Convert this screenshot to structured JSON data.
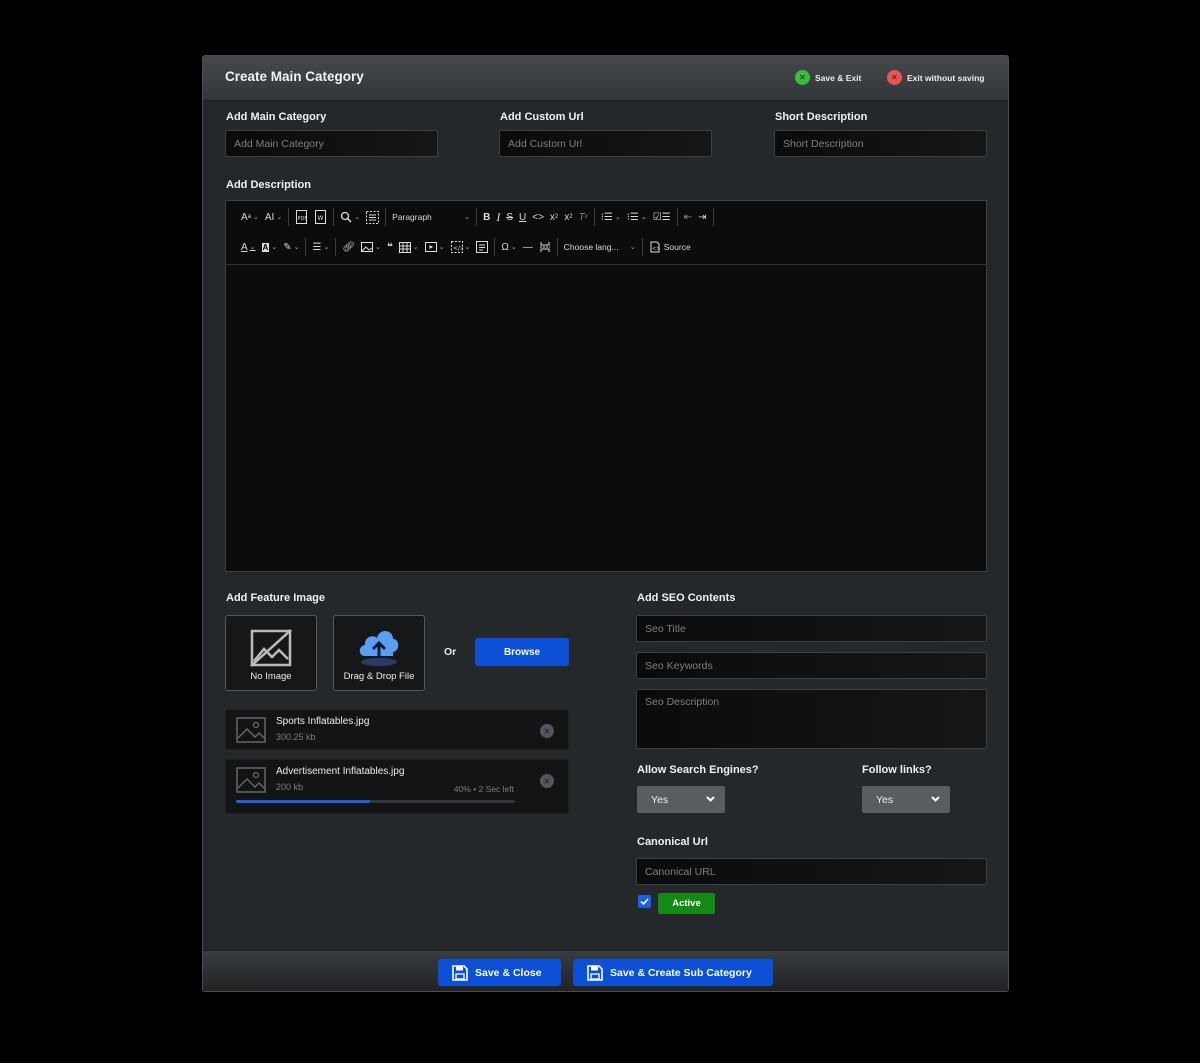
{
  "modal": {
    "title": "Create Main Category",
    "save_exit": "Save & Exit",
    "exit_no_save": "Exit without saving"
  },
  "fields": {
    "main_category": {
      "label": "Add Main Category",
      "placeholder": "Add Main Category",
      "value": ""
    },
    "custom_url": {
      "label": "Add Custom Url",
      "placeholder": "Add Custom Url",
      "value": ""
    },
    "short_description": {
      "label": "Short Description",
      "placeholder": "Short Description",
      "value": ""
    },
    "description_label": "Add Description"
  },
  "editor": {
    "paragraph": "Paragraph",
    "choose_language": "Choose lang...",
    "source": "Source"
  },
  "feature_image": {
    "label": "Add Feature Image",
    "no_image": "No Image",
    "drag_drop": "Drag & Drop File",
    "or": "Or",
    "browse": "Browse",
    "files": [
      {
        "name": "Sports Inflatables.jpg",
        "size": "300.25 kb"
      },
      {
        "name": "Advertisement Inflatables.jpg",
        "size": "200 kb",
        "status": "40% • 2 Sec left",
        "progress": 0.48
      }
    ]
  },
  "seo": {
    "label": "Add SEO Contents",
    "title_placeholder": "Seo Title",
    "keywords_placeholder": "Seo Keywords",
    "description_placeholder": "Seo Description",
    "allow_label": "Allow Search Engines?",
    "allow_value": "Yes",
    "follow_label": "Follow links?",
    "follow_value": "Yes",
    "canonical_label": "Canonical Url",
    "canonical_placeholder": "Canonical URL",
    "active_label": "Active",
    "active_checked": true
  },
  "footer": {
    "save_close": "Save & Close",
    "save_create_sub": "Save & Create Sub Category"
  },
  "colors": {
    "accent": "#0d50d8",
    "success": "#128a13",
    "save_dot": "#3bbd3b",
    "exit_dot": "#e8574f"
  }
}
